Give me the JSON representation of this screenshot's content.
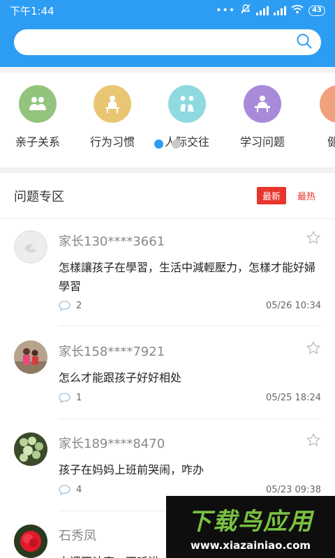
{
  "status": {
    "time": "下午1:44",
    "battery": "43"
  },
  "search": {
    "placeholder": ""
  },
  "categories": [
    {
      "label": "亲子关系",
      "color": "#93c47d",
      "icon": "parents-icon"
    },
    {
      "label": "行为习惯",
      "color": "#e8c673",
      "icon": "student-desk-icon"
    },
    {
      "label": "人际交往",
      "color": "#8fd9e0",
      "icon": "friends-icon"
    },
    {
      "label": "学习问题",
      "color": "#a98ad9",
      "icon": "reading-icon"
    },
    {
      "label": "健康",
      "color": "#f0a07a",
      "icon": "health-icon"
    }
  ],
  "carousel": {
    "pages": 2,
    "active": 0
  },
  "section": {
    "title": "问题专区",
    "filter_new": "最新",
    "filter_hot": "最热"
  },
  "posts": [
    {
      "name": "家长130****3661",
      "text": "怎樣讓孩子在學習，生活中減輕壓力，怎樣才能好婦學習",
      "comments": "2",
      "time": "05/26 10:34",
      "avatar": "default-avatar"
    },
    {
      "name": "家长158****7921",
      "text": "怎么才能跟孩子好好相处",
      "comments": "1",
      "time": "05/25 18:24",
      "avatar": "kids-photo-avatar"
    },
    {
      "name": "家长189****8470",
      "text": "孩子在妈妈上班前哭闹，咋办",
      "comments": "4",
      "time": "05/23 09:38",
      "avatar": "plant-photo-avatar"
    },
    {
      "name": "石秀凤",
      "text": "上课不认真，不听讲",
      "comments": "",
      "time": "",
      "avatar": "flower-photo-avatar"
    }
  ],
  "watermark": {
    "title": "下载鸟应用",
    "url": "www.xiazainiao.com"
  }
}
